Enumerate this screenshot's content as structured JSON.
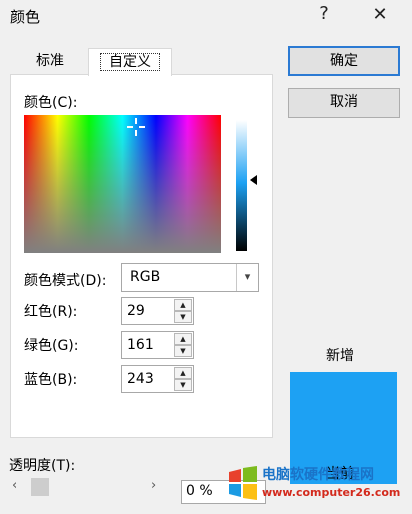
{
  "window": {
    "title": "颜色",
    "help_glyph": "?",
    "close_glyph": "✕"
  },
  "tabs": [
    {
      "label": "标准",
      "active": false
    },
    {
      "label": "自定义",
      "active": true
    }
  ],
  "color_picker": {
    "label": "颜色(C):"
  },
  "color_model": {
    "label": "颜色模式(D):",
    "value": "RGB",
    "dropdown_glyph": "▾"
  },
  "rgb": {
    "red": {
      "label": "红色(R):",
      "value": "29"
    },
    "green": {
      "label": "绿色(G):",
      "value": "161"
    },
    "blue": {
      "label": "蓝色(B):",
      "value": "243"
    }
  },
  "buttons": {
    "ok": "确定",
    "cancel": "取消"
  },
  "preview": {
    "new_label": "新增",
    "current_label": "当前",
    "color": "#1da1f3"
  },
  "transparency": {
    "label": "透明度(T):",
    "value": "0 %",
    "left_glyph": "‹",
    "right_glyph": "›"
  },
  "watermark": {
    "line1": "电脑软硬件教程网",
    "line2": "www.computer26.com"
  }
}
